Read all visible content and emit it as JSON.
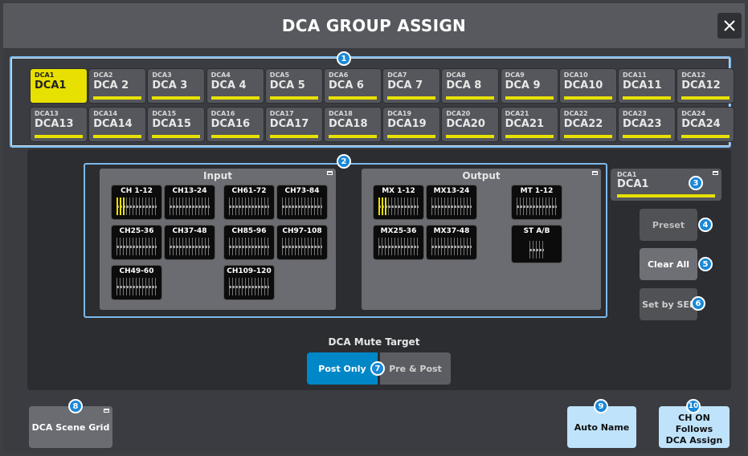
{
  "window": {
    "title": "DCA GROUP ASSIGN"
  },
  "dca_buttons": [
    {
      "small": "DCA1",
      "name": "DCA1",
      "selected": true
    },
    {
      "small": "DCA2",
      "name": "DCA 2"
    },
    {
      "small": "DCA3",
      "name": "DCA 3"
    },
    {
      "small": "DCA4",
      "name": "DCA 4"
    },
    {
      "small": "DCA5",
      "name": "DCA 5"
    },
    {
      "small": "DCA6",
      "name": "DCA 6"
    },
    {
      "small": "DCA7",
      "name": "DCA 7"
    },
    {
      "small": "DCA8",
      "name": "DCA 8"
    },
    {
      "small": "DCA9",
      "name": "DCA 9"
    },
    {
      "small": "DCA10",
      "name": "DCA10"
    },
    {
      "small": "DCA11",
      "name": "DCA11"
    },
    {
      "small": "DCA12",
      "name": "DCA12"
    },
    {
      "small": "DCA13",
      "name": "DCA13"
    },
    {
      "small": "DCA14",
      "name": "DCA14"
    },
    {
      "small": "DCA15",
      "name": "DCA15"
    },
    {
      "small": "DCA16",
      "name": "DCA16"
    },
    {
      "small": "DCA17",
      "name": "DCA17"
    },
    {
      "small": "DCA18",
      "name": "DCA18"
    },
    {
      "small": "DCA19",
      "name": "DCA19"
    },
    {
      "small": "DCA20",
      "name": "DCA20"
    },
    {
      "small": "DCA21",
      "name": "DCA21"
    },
    {
      "small": "DCA22",
      "name": "DCA22"
    },
    {
      "small": "DCA23",
      "name": "DCA23"
    },
    {
      "small": "DCA24",
      "name": "DCA24"
    }
  ],
  "input": {
    "label": "Input",
    "channels": [
      "CH 1-12",
      "CH13-24",
      "CH61-72",
      "CH73-84",
      "CH25-36",
      "CH37-48",
      "CH85-96",
      "CH97-108",
      "CH49-60",
      "CH109-120"
    ]
  },
  "output": {
    "label": "Output",
    "channels": [
      "MX 1-12",
      "MX13-24",
      "MT 1-12",
      "MX25-36",
      "MX37-48",
      "ST A/B"
    ]
  },
  "selected_dca": {
    "small": "DCA1",
    "name": "DCA1"
  },
  "buttons": {
    "preset": "Preset",
    "clear_all": "Clear All",
    "set_by_sel": "Set by SEL",
    "auto_name": "Auto Name",
    "dca_scene_grid": "DCA Scene Grid",
    "ch_on_1": "CH ON",
    "ch_on_2": "Follows",
    "ch_on_3": "DCA Assign"
  },
  "mute_target": {
    "label": "DCA Mute Target",
    "post_only": "Post Only",
    "pre_post": "Pre & Post",
    "selected": "Post Only"
  },
  "badges": [
    "1",
    "2",
    "3",
    "4",
    "5",
    "6",
    "7",
    "8",
    "9",
    "10"
  ],
  "colors": {
    "accent_blue": "#0087c8",
    "dca_yellow": "#e8e000",
    "highlight_frame": "#7fb8e8",
    "light_button": "#bfe3fb"
  }
}
